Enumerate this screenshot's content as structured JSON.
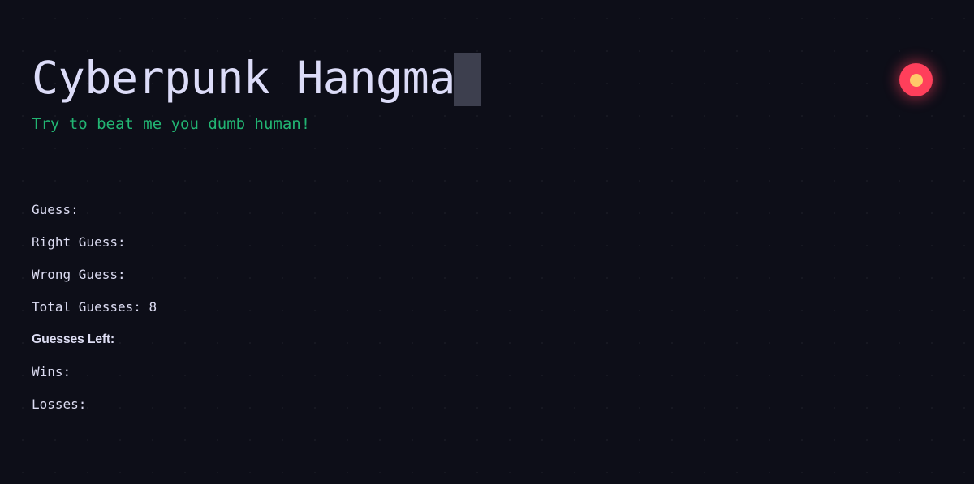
{
  "header": {
    "title": "Cyberpunk Hangman",
    "subtitle": "Try to beat me you dumb human!"
  },
  "status_indicator": {
    "outer_color": "#ff3f5b",
    "inner_color": "#ffc869"
  },
  "stats": {
    "guess_label": "Guess:",
    "guess_value": "",
    "right_guess_label": "Right Guess:",
    "right_guess_value": "",
    "wrong_guess_label": "Wrong Guess:",
    "wrong_guess_value": "",
    "total_guesses_label": "Total Guesses:",
    "total_guesses_value": "8",
    "guesses_left_label": "Guesses Left:",
    "guesses_left_value": "",
    "wins_label": "Wins:",
    "wins_value": "",
    "losses_label": "Losses:",
    "losses_value": ""
  },
  "colors": {
    "background": "#0d0e18",
    "title_text": "#dcdcf8",
    "subtitle_text": "#22b573",
    "cursor": "#3d3f4e"
  }
}
